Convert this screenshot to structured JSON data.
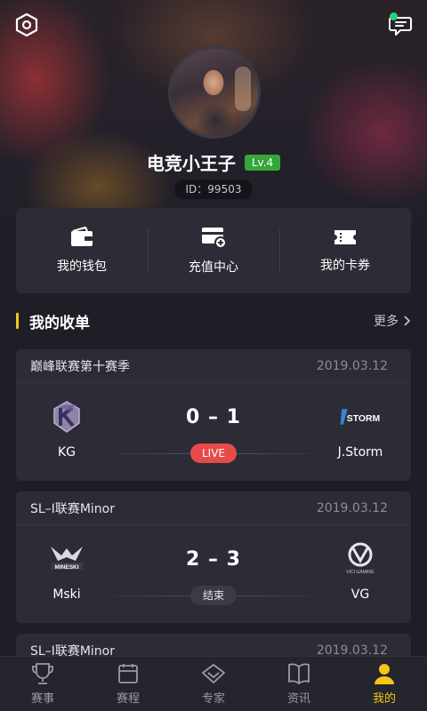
{
  "profile": {
    "username": "电竞小王子",
    "level": "Lv.4",
    "id_text": "ID：99503"
  },
  "wallet": [
    {
      "label": "我的钱包",
      "icon": "wallet-icon"
    },
    {
      "label": "充值中心",
      "icon": "recharge-card-icon"
    },
    {
      "label": "我的卡券",
      "icon": "ticket-icon"
    }
  ],
  "section": {
    "title": "我的收单",
    "more": "更多"
  },
  "matches": [
    {
      "league": "巅峰联赛第十赛季",
      "date": "2019.03.12",
      "team_left": "KG",
      "team_right": "J.Storm",
      "score": "0 – 1",
      "status": "LIVE"
    },
    {
      "league": "SL–I联赛Minor",
      "date": "2019.03.12",
      "team_left": "Mski",
      "team_right": "VG",
      "score": "2 – 3",
      "status": "结束"
    },
    {
      "league": "SL–I联赛Minor",
      "date": "2019.03.12"
    }
  ],
  "tabs": [
    {
      "label": "赛事",
      "icon": "trophy-icon"
    },
    {
      "label": "赛程",
      "icon": "calendar-icon"
    },
    {
      "label": "专家",
      "icon": "diamond-icon"
    },
    {
      "label": "资讯",
      "icon": "book-icon"
    },
    {
      "label": "我的",
      "icon": "user-icon",
      "active": true
    }
  ],
  "colors": {
    "accent": "#f5c518",
    "live": "#e84a4a",
    "level_badge": "#35a63a",
    "card": "#2b2c35",
    "background": "#1e1f26"
  }
}
